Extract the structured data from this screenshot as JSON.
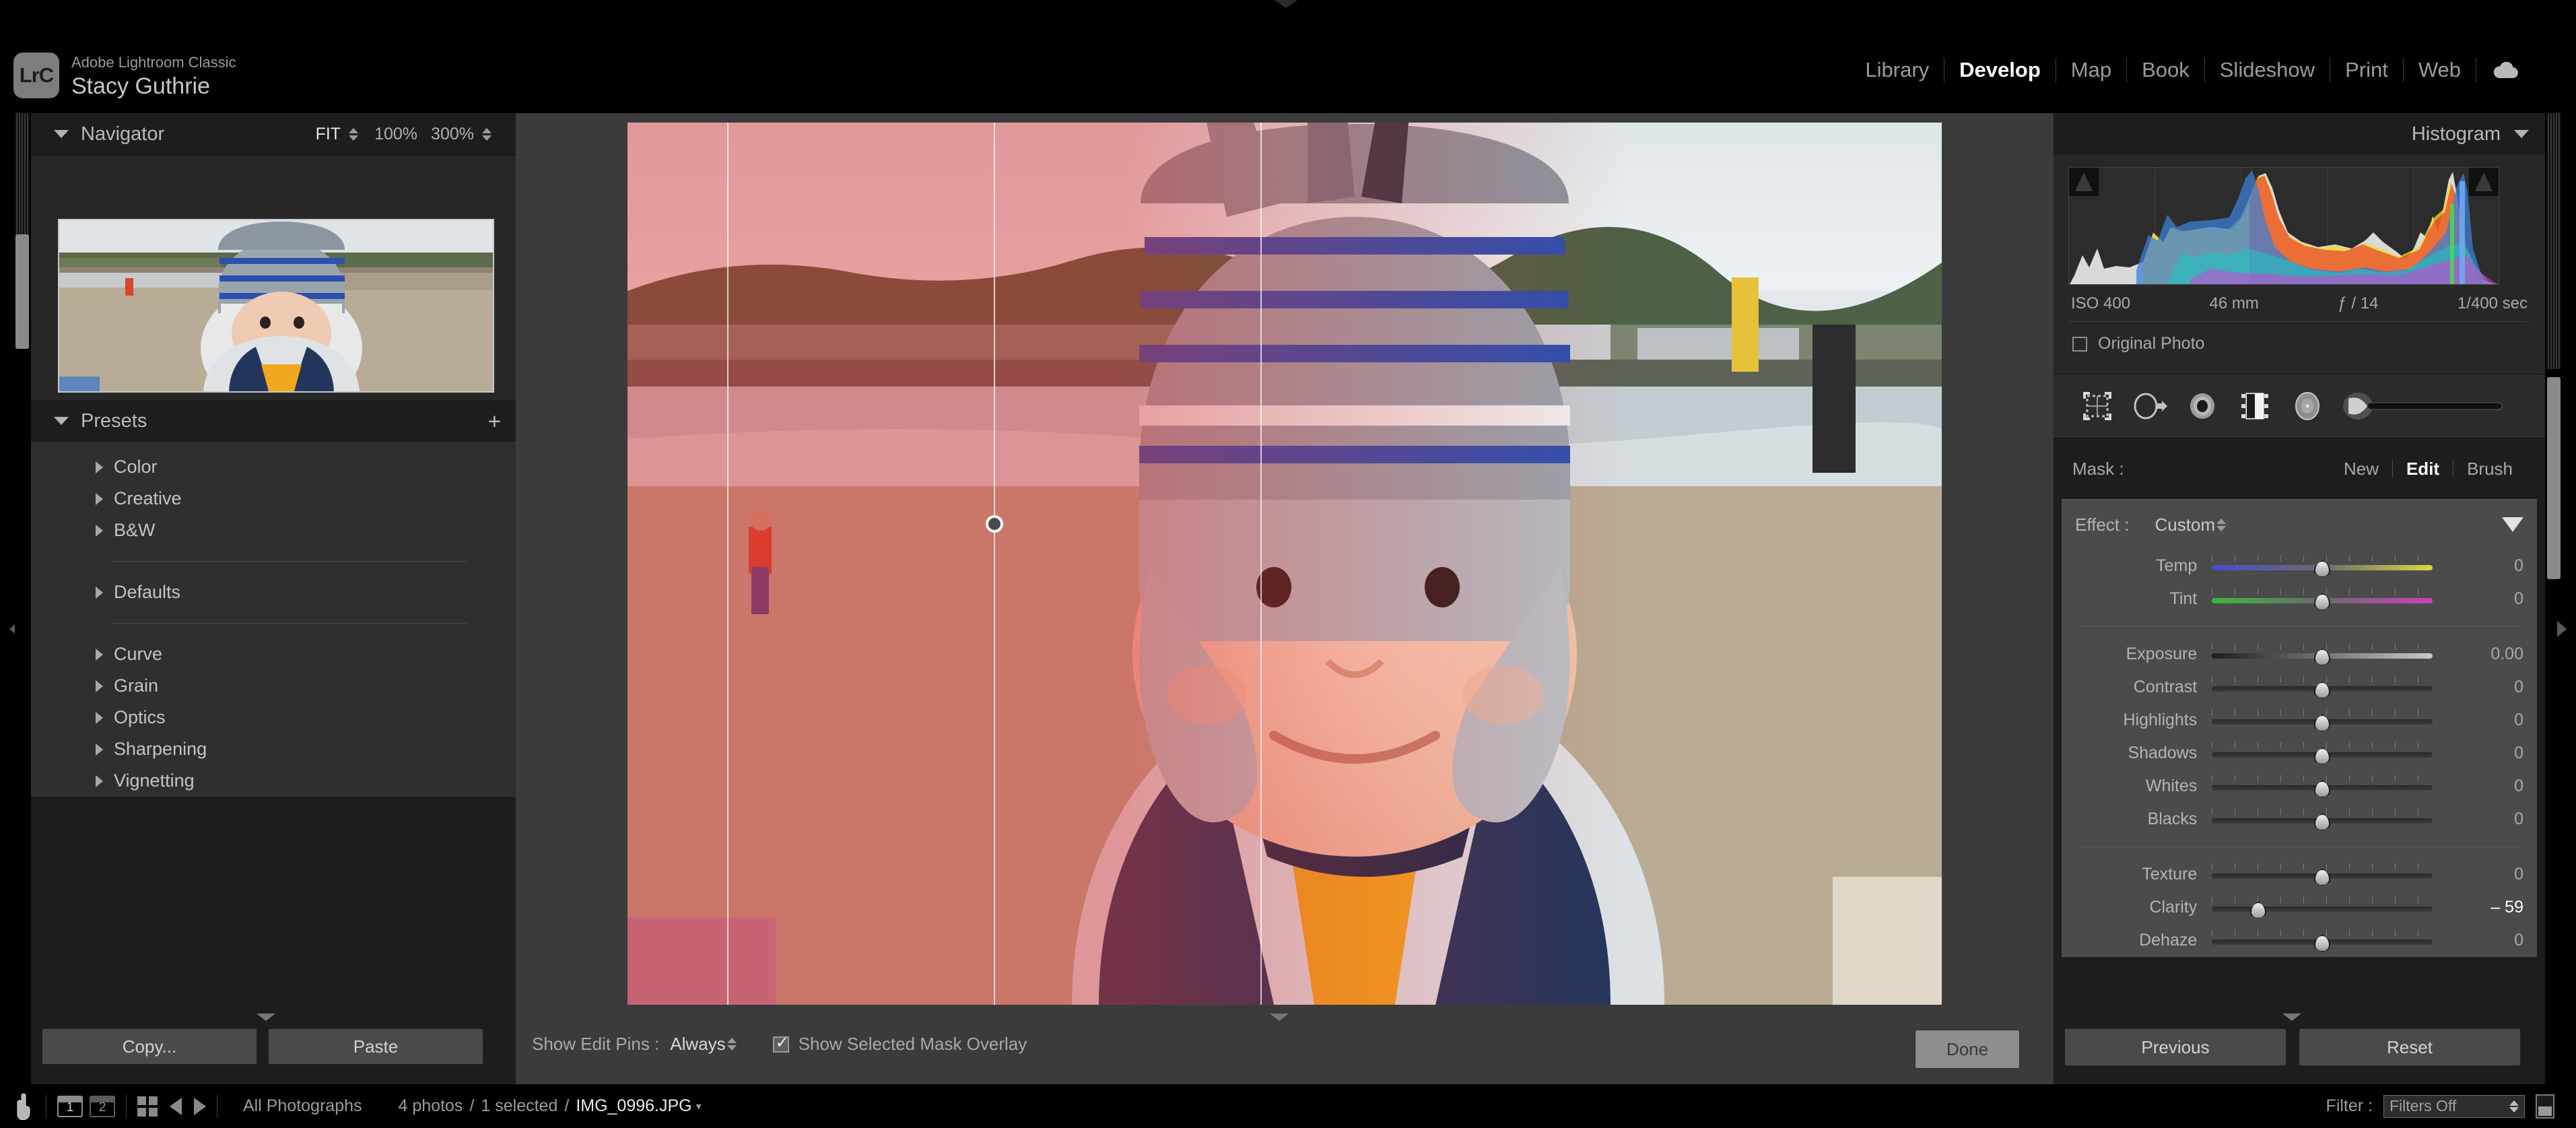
{
  "app": {
    "logo_text": "LrC",
    "product_name": "Adobe Lightroom Classic",
    "user_name": "Stacy Guthrie"
  },
  "modules": [
    {
      "label": "Library",
      "active": false
    },
    {
      "label": "Develop",
      "active": true
    },
    {
      "label": "Map",
      "active": false
    },
    {
      "label": "Book",
      "active": false
    },
    {
      "label": "Slideshow",
      "active": false
    },
    {
      "label": "Print",
      "active": false
    },
    {
      "label": "Web",
      "active": false
    }
  ],
  "cloud_icon": "cloud-sync-icon",
  "navigator": {
    "title": "Navigator",
    "zoom_levels": [
      {
        "label": "FIT",
        "active": true
      },
      {
        "label": "100%",
        "active": false
      },
      {
        "label": "300%",
        "active": false
      }
    ]
  },
  "presets": {
    "title": "Presets",
    "add_label": "+",
    "groups": [
      {
        "label": "Color"
      },
      {
        "label": "Creative"
      },
      {
        "label": "B&W"
      },
      {
        "divider": true
      },
      {
        "label": "Defaults"
      },
      {
        "divider": true
      },
      {
        "label": "Curve"
      },
      {
        "label": "Grain"
      },
      {
        "label": "Optics"
      },
      {
        "label": "Sharpening"
      },
      {
        "label": "Vignetting"
      }
    ]
  },
  "left_footer": {
    "copy_label": "Copy...",
    "paste_label": "Paste"
  },
  "canvas": {
    "mask_overlay_color": "#e22d2d",
    "pin_name": "linear-gradient-mask-pin"
  },
  "center_toolbar": {
    "show_edit_pins_label": "Show Edit Pins :",
    "show_edit_pins_value": "Always",
    "mask_overlay_label": "Show Selected Mask Overlay",
    "mask_overlay_checked": true,
    "done_label": "Done"
  },
  "histogram": {
    "title": "Histogram",
    "iso": "ISO 400",
    "focal_length": "46 mm",
    "aperture": "ƒ / 14",
    "shutter": "1/400 sec",
    "original_photo_label": "Original Photo",
    "original_photo_checked": false
  },
  "tool_strip": [
    {
      "name": "crop-overlay-icon",
      "selected": false
    },
    {
      "name": "spot-removal-icon",
      "selected": false
    },
    {
      "name": "red-eye-icon",
      "selected": false
    },
    {
      "name": "masking-icon",
      "selected": true
    },
    {
      "name": "radial-gradient-icon",
      "selected": false
    },
    {
      "name": "adjustment-brush-icon",
      "selected": false
    }
  ],
  "mask_row": {
    "label": "Mask :",
    "actions": [
      {
        "label": "New",
        "active": false
      },
      {
        "label": "Edit",
        "active": true
      },
      {
        "label": "Brush",
        "active": false
      }
    ]
  },
  "effect_row": {
    "label": "Effect :",
    "value": "Custom"
  },
  "sliders": [
    {
      "label": "Temp",
      "value": "0",
      "pos": 50,
      "track": "temp",
      "modified": false
    },
    {
      "label": "Tint",
      "value": "0",
      "pos": 50,
      "track": "tint",
      "modified": false
    },
    {
      "divider": true
    },
    {
      "label": "Exposure",
      "value": "0.00",
      "pos": 50,
      "track": "expo",
      "modified": false
    },
    {
      "label": "Contrast",
      "value": "0",
      "pos": 50,
      "track": "plain",
      "modified": false
    },
    {
      "label": "Highlights",
      "value": "0",
      "pos": 50,
      "track": "plain",
      "modified": false
    },
    {
      "label": "Shadows",
      "value": "0",
      "pos": 50,
      "track": "plain",
      "modified": false
    },
    {
      "label": "Whites",
      "value": "0",
      "pos": 50,
      "track": "plain",
      "modified": false
    },
    {
      "label": "Blacks",
      "value": "0",
      "pos": 50,
      "track": "plain",
      "modified": false
    },
    {
      "divider": true
    },
    {
      "label": "Texture",
      "value": "0",
      "pos": 50,
      "track": "plain",
      "modified": false
    },
    {
      "label": "Clarity",
      "value": "– 59",
      "pos": 21,
      "track": "plain",
      "modified": true
    },
    {
      "label": "Dehaze",
      "value": "0",
      "pos": 50,
      "track": "plain",
      "modified": false
    }
  ],
  "right_footer": {
    "previous_label": "Previous",
    "reset_label": "Reset"
  },
  "filmstrip_bar": {
    "lights_icon": "hand-pointer-icon",
    "screen_one": "1",
    "screen_two": "2",
    "grid_icon": "grid-view-icon",
    "back_icon": "navigate-back-icon",
    "forward_icon": "navigate-forward-icon",
    "source": "All Photographs",
    "photo_count": "4 photos",
    "selection": "1 selected",
    "filename": "IMG_0996.JPG",
    "filter_label": "Filter :",
    "filter_value": "Filters Off"
  }
}
